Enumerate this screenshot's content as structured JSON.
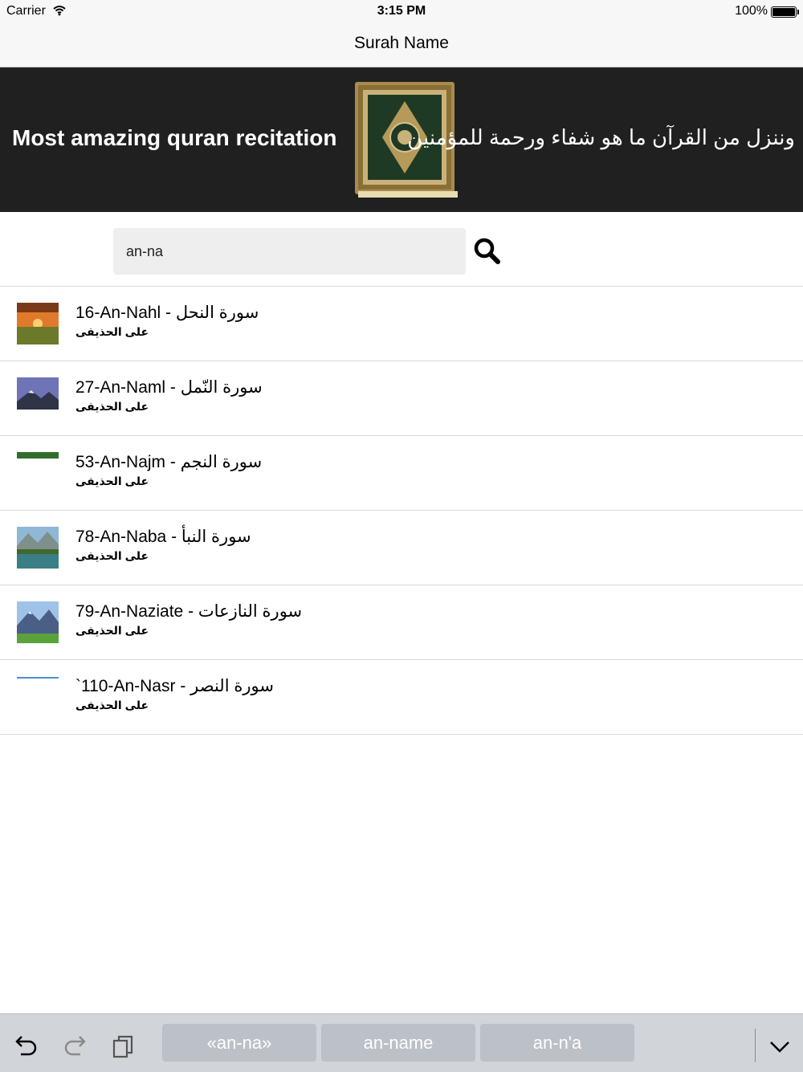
{
  "status_bar": {
    "carrier": "Carrier",
    "time": "3:15 PM",
    "battery_pct": "100%"
  },
  "nav": {
    "title": "Surah Name"
  },
  "banner": {
    "english": "Most amazing quran recitation",
    "arabic": "وننزل من القرآن ما هو شفاء  ورحمة للمؤمنين"
  },
  "search": {
    "value": "an-na",
    "icon": "search-icon"
  },
  "results": [
    {
      "title": "16-An-Nahl - سورة النحل",
      "reciter": "على الحذيفى",
      "thumb": "sunset-field"
    },
    {
      "title": "27-An-Naml - سورة النّمل",
      "reciter": "على الحذيفى",
      "thumb": "mountain-lake"
    },
    {
      "title": "53-An-Najm - سورة النجم",
      "reciter": "على الحذيفى",
      "thumb": "grass-strip"
    },
    {
      "title": "78-An-Naba - سورة النبأ",
      "reciter": "على الحذيفى",
      "thumb": "lake-reflection"
    },
    {
      "title": "79-An-Naziate - سورة النازعات",
      "reciter": "على الحذيفى",
      "thumb": "alpine-valley"
    },
    {
      "title": "`110-An-Nasr - سورة النصر",
      "reciter": "على الحذيفى",
      "thumb": "sky-strip"
    }
  ],
  "keyboard_bar": {
    "suggestions": [
      "«an-na»",
      "an-name",
      "an-n'a"
    ],
    "icons": [
      "undo-icon",
      "redo-icon",
      "paste-icon",
      "chevron-down-icon"
    ]
  },
  "colors": {
    "banner_bg": "#202020",
    "search_bg": "#eeeeee",
    "suggestion_bg": "#bcc0c7",
    "keyboard_bar_bg": "#d1d4d9"
  }
}
